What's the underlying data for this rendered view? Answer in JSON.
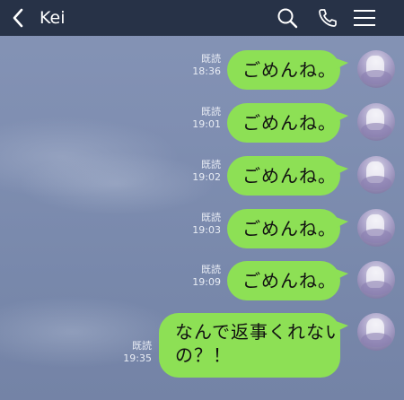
{
  "header": {
    "title": "Kei",
    "back_icon": "chevron-left-icon",
    "search_icon": "search-icon",
    "call_icon": "phone-icon",
    "menu_icon": "menu-icon",
    "background_color": "#273247"
  },
  "chat": {
    "background_color": "#7f8eb1",
    "bubble_color": "#8de055",
    "messages": [
      {
        "text": "ごめんね。",
        "read_label": "既読",
        "time": "18:36"
      },
      {
        "text": "ごめんね。",
        "read_label": "既読",
        "time": "19:01"
      },
      {
        "text": "ごめんね。",
        "read_label": "既読",
        "time": "19:02"
      },
      {
        "text": "ごめんね。",
        "read_label": "既読",
        "time": "19:03"
      },
      {
        "text": "ごめんね。",
        "read_label": "既読",
        "time": "19:09"
      },
      {
        "text_line1": "なんで返事くれないの",
        "text_line2": "の？！",
        "read_label": "既読",
        "time": "19:35"
      }
    ]
  }
}
